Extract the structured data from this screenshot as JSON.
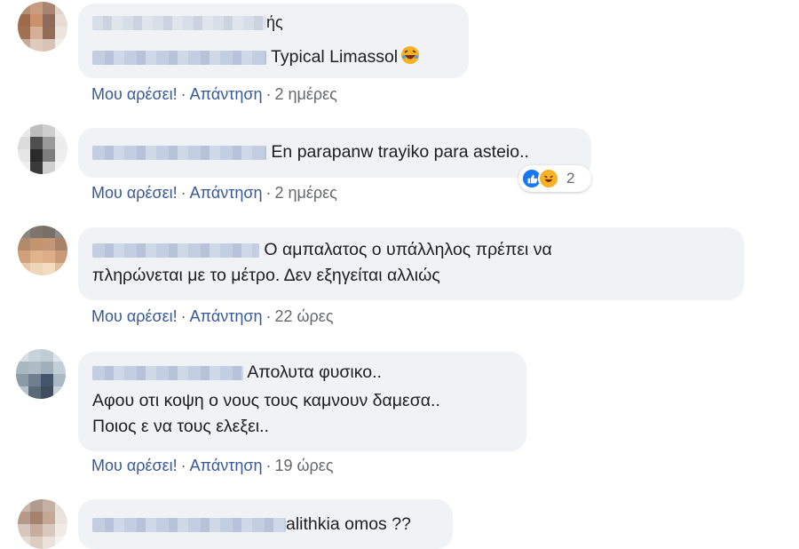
{
  "comments": [
    {
      "name_suffix": "ής",
      "text": "Typical Limassol",
      "emoji": "rofl-emoji-icon",
      "actions": {
        "like": "Μου αρέσει!",
        "reply": "Απάντηση",
        "time": "2 ημέρες"
      }
    },
    {
      "text": "En parapanw trayiko para asteio..",
      "reactions": {
        "icons": [
          "like-reaction-icon",
          "haha-reaction-icon"
        ],
        "count": "2"
      },
      "actions": {
        "like": "Μου αρέσει!",
        "reply": "Απάντηση",
        "time": "2 ημέρες"
      }
    },
    {
      "lines": [
        "Ο αμπαλατος ο υπάλληλος πρέπει να",
        "πληρώνεται με το μέτρο. Δεν εξηγείται αλλιώς"
      ],
      "actions": {
        "like": "Μου αρέσει!",
        "reply": "Απάντηση",
        "time": "22 ώρες"
      }
    },
    {
      "lines": [
        "Απολυτα φυσικο..",
        "Αφου οτι κοψη ο νους τους καμνουν δαμεσα..",
        "Ποιος ε να τους ελεξει.."
      ],
      "actions": {
        "like": "Μου αρέσει!",
        "reply": "Απάντηση",
        "time": "19 ώρες"
      }
    },
    {
      "text": "alithkia omos ??"
    }
  ],
  "colors": {
    "bubble": "#f0f2f5",
    "link": "#385898",
    "muted": "#65676b",
    "like_blue": "#1877f2",
    "haha_yellow": "#f7b125"
  }
}
